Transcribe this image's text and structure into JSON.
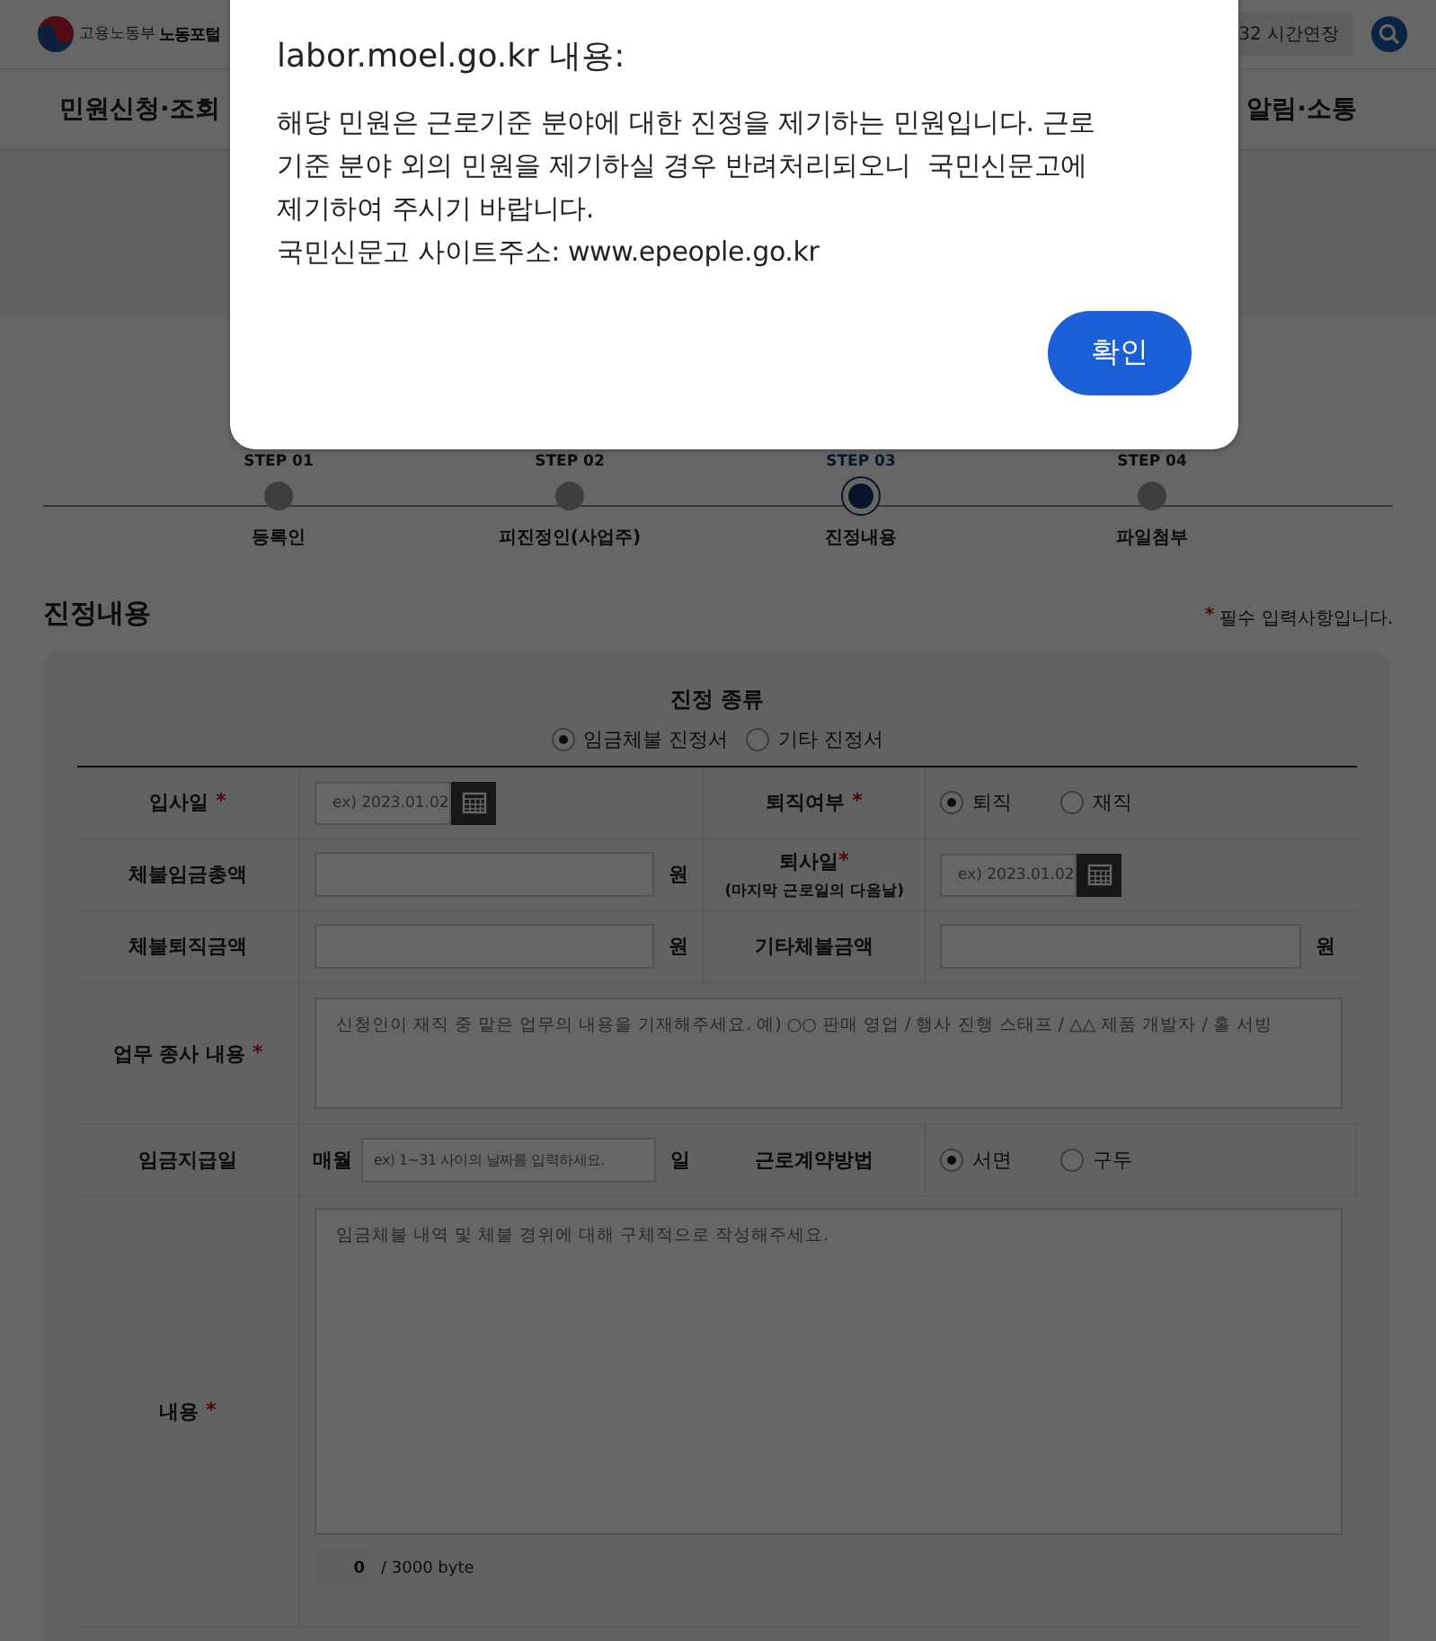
{
  "header": {
    "org": "고용노동부",
    "portal": "노동포털",
    "session_button": "32 시간연장"
  },
  "nav": [
    {
      "label": "민원신청·조회"
    },
    {
      "label": "알림·소통"
    }
  ],
  "steps": [
    {
      "step": "STEP 01",
      "label": "등록인",
      "selected": false
    },
    {
      "step": "STEP 02",
      "label": "피진정인(사업주)",
      "selected": false
    },
    {
      "step": "STEP 03",
      "label": "진정내용",
      "selected": true
    },
    {
      "step": "STEP 04",
      "label": "파일첨부",
      "selected": false
    }
  ],
  "section": {
    "title": "진정내용",
    "note_mark": "*",
    "note": "필수 입력사항입니다."
  },
  "form": {
    "type_title": "진정 종류",
    "types": [
      {
        "label": "임금체불 진정서",
        "selected": true
      },
      {
        "label": "기타 진정서",
        "selected": false
      }
    ],
    "rows": [
      {
        "cells": [
          {
            "kind": "label",
            "text": "입사일",
            "mark": "*"
          },
          {
            "kind": "date",
            "placeholder": "ex) 2023.01.02"
          },
          {
            "kind": "label",
            "text": "퇴직여부",
            "mark": "*"
          },
          {
            "kind": "radios",
            "options": [
              {
                "label": "퇴직",
                "selected": true
              },
              {
                "label": "재직",
                "selected": false
              }
            ]
          }
        ]
      },
      {
        "cells": [
          {
            "kind": "label",
            "text": "체불임금총액"
          },
          {
            "kind": "amount",
            "unit": "원"
          },
          {
            "kind": "label",
            "text": "퇴사일",
            "mark": "*",
            "sub": "(마지막 근로일의 다음날)"
          },
          {
            "kind": "date",
            "placeholder": "ex) 2023.01.02"
          }
        ]
      },
      {
        "cells": [
          {
            "kind": "label",
            "text": "체불퇴직금액"
          },
          {
            "kind": "amount",
            "unit": "원"
          },
          {
            "kind": "label",
            "text": "기타체불금액"
          },
          {
            "kind": "amount",
            "unit": "원"
          }
        ]
      },
      {
        "cells": [
          {
            "kind": "label",
            "text": "업무 종사 내용",
            "mark": "*"
          },
          {
            "kind": "textarea",
            "placeholder": "신청인이 재직 중 맡은 업무의 내용을 기재해주세요. 예) ○○ 판매 영업 / 행사 진행 스태프 / △△ 제품 개발자 / 홀 서빙"
          }
        ]
      },
      {
        "cells": [
          {
            "kind": "label",
            "text": "임금지급일"
          },
          {
            "kind": "payday",
            "prefix": "매월",
            "placeholder": "ex) 1~31 사이의 날짜를 입력하세요.",
            "unit": "일"
          },
          {
            "kind": "label",
            "text": "근로계약방법"
          },
          {
            "kind": "radios",
            "options": [
              {
                "label": "서면",
                "selected": true
              },
              {
                "label": "구두",
                "selected": false
              }
            ]
          }
        ]
      },
      {
        "cells": [
          {
            "kind": "label",
            "text": "내용",
            "mark": "*"
          },
          {
            "kind": "bigtext",
            "placeholder": "임금체불 내역 및 체불 경위에 대해 구체적으로 작성해주세요.",
            "count": "0",
            "limit": "/ 3000 byte"
          }
        ]
      }
    ]
  },
  "dialog": {
    "title": "labor.moel.go.kr 내용:",
    "message": [
      "해당 민원은 근로기준 분야에 대한 진정을 제기하는 민원입니다. 근로기준 분야 외의 민원을 제기하실 경우 반려처리되오니  국민신문고에 제기하여 주시기 바랍니다.",
      "국민신문고 사이트주소: www.epeople.go.kr"
    ],
    "button": "확인"
  }
}
